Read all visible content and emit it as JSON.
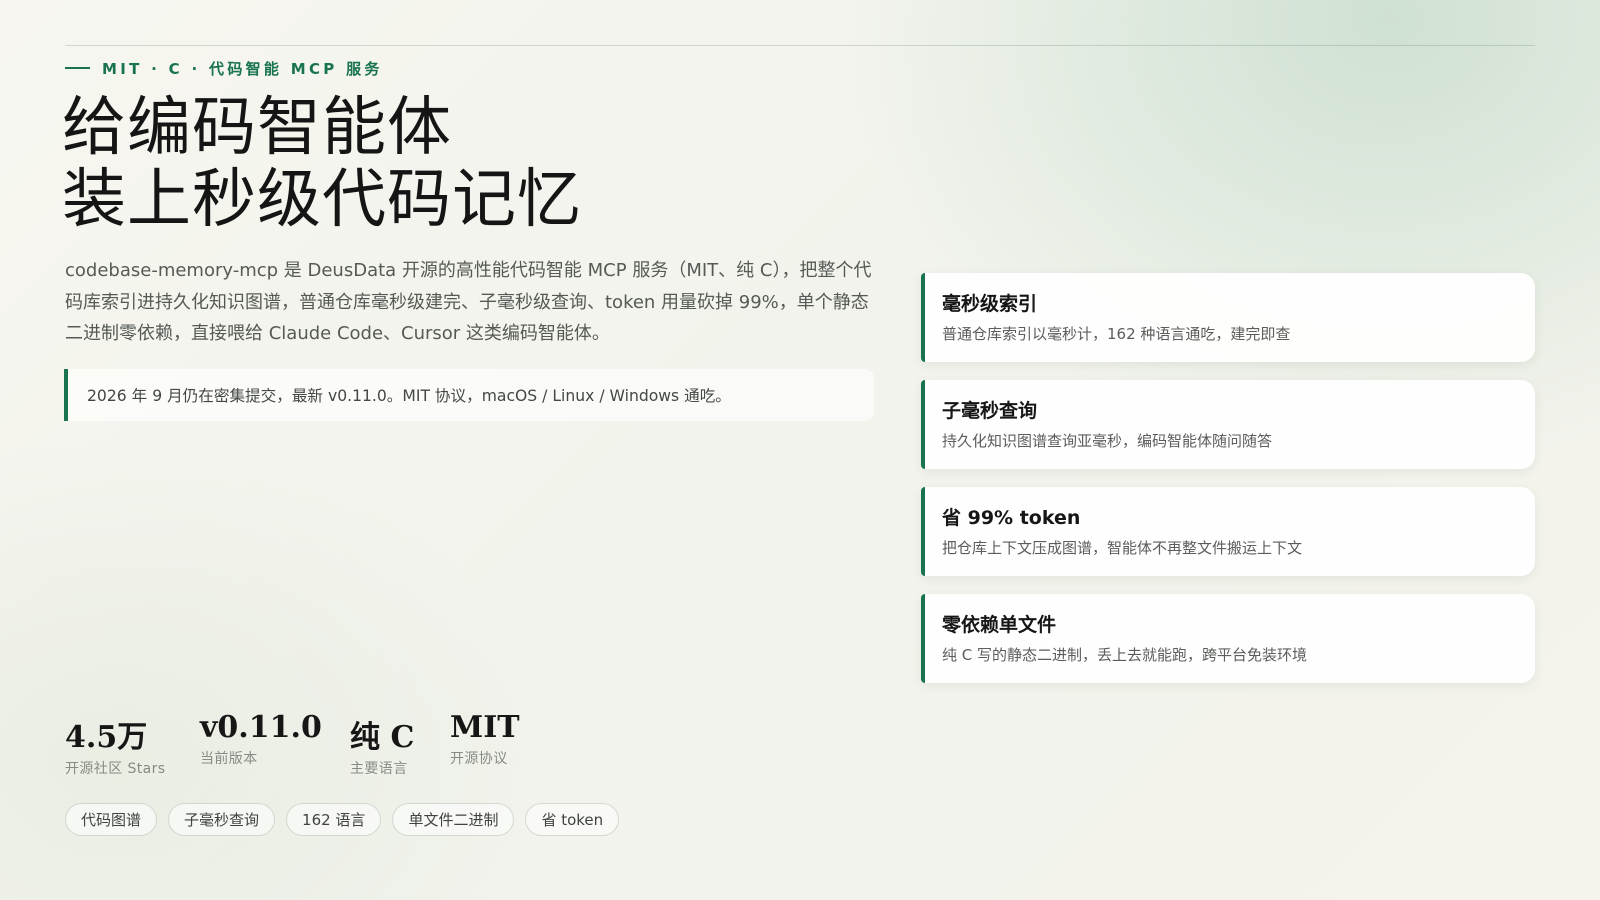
{
  "header": {
    "eyebrow": "MIT · C · 代码智能 MCP 服务"
  },
  "hero": {
    "title_lines": [
      "给编码智能体",
      "装上秒级代码记忆"
    ],
    "description": "codebase-memory-mcp 是 DeusData 开源的高性能代码智能 MCP 服务（MIT、纯 C），把整个代码库索引进持久化知识图谱，普通仓库毫秒级建完、子毫秒级查询、token 用量砍掉 99%，单个静态二进制零依赖，直接喂给 Claude Code、Cursor 这类编码智能体。",
    "note": "2026 年 9 月仍在密集提交，最新 v0.11.0。MIT 协议，macOS / Linux / Windows 通吃。"
  },
  "features": [
    {
      "title": "毫秒级索引",
      "description": "普通仓库索引以毫秒计，162 种语言通吃，建完即查"
    },
    {
      "title": "子毫秒查询",
      "description": "持久化知识图谱查询亚毫秒，编码智能体随问随答"
    },
    {
      "title": "省 99% token",
      "description": "把仓库上下文压成图谱，智能体不再整文件搬运上下文"
    },
    {
      "title": "零依赖单文件",
      "description": "纯 C 写的静态二进制，丢上去就能跑，跨平台免装环境"
    }
  ],
  "stats": [
    {
      "value": "4.5万",
      "label": "开源社区 Stars"
    },
    {
      "value": "v0.11.0",
      "label": "当前版本"
    },
    {
      "value": "纯 C",
      "label": "主要语言"
    },
    {
      "value": "MIT",
      "label": "开源协议"
    }
  ],
  "tags": [
    "代码图谱",
    "子毫秒查询",
    "162 语言",
    "单文件二进制",
    "省 token"
  ],
  "colors": {
    "accent": "#19734f",
    "title": "#151515",
    "body_text": "#555a56",
    "background": "#f4f3ec",
    "card_background": "#ffffff"
  }
}
